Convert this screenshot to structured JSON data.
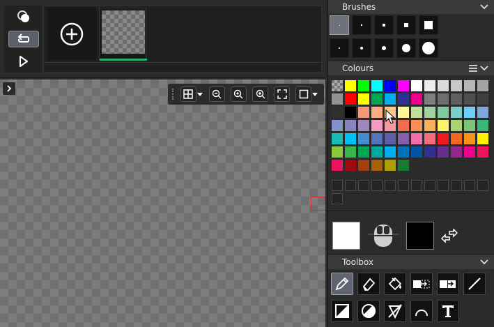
{
  "panels": {
    "brushes_title": "Brushes",
    "colours_title": "Colours",
    "toolbox_title": "Toolbox"
  },
  "palette": [
    [
      "checker",
      "#ffff00",
      "#00ff00",
      "#00ffff",
      "#0000ff",
      "#ff00ff",
      "#ffffff",
      "#ececec",
      "#dadada",
      "#c8c8c8",
      "#b6b6b6",
      "#a4a4a4"
    ],
    [
      "#929292",
      "#ff0000",
      "#ffff00",
      "#00a651",
      "#00aeef",
      "#2e3192",
      "#ec008c",
      "#7f7f7f",
      "#6f6f6f",
      "#5f5f5f",
      "#4f4f4f",
      "#3f3f3f"
    ],
    [
      "#2f2f2f",
      "#000000",
      "#f7977a",
      "#f9ad81",
      "#fdc68a",
      "#fff79a",
      "#c4df9b",
      "#a3d39c",
      "#82ca9d",
      "#7bcdc8",
      "#6ecff6",
      "#7ea7d8"
    ],
    [
      "#8493ca",
      "#8882be",
      "#a187be",
      "#f49ac2",
      "#f6989d",
      "#f26c4f",
      "#f68e56",
      "#fbaf5d",
      "#fff467",
      "#acd373",
      "#7cc576",
      "#3bb878"
    ],
    [
      "#1abbb4",
      "#00bff3",
      "#448ccb",
      "#5674b9",
      "#605ca8",
      "#855fa8",
      "#f06eaa",
      "#f26d7d",
      "#ed1c24",
      "#f26522",
      "#f7941d",
      "#fff200"
    ],
    [
      "#8dc73f",
      "#39b54a",
      "#00a651",
      "#00a99d",
      "#00aeef",
      "#0072bc",
      "#0054a6",
      "#2e3192",
      "#662d91",
      "#92278f",
      "#ec008c",
      "#ed145b"
    ],
    [
      "#ed145b",
      "#9e0b0f",
      "#a0410d",
      "#a3620a",
      "#aba000",
      "#197b30"
    ]
  ],
  "colours": {
    "primary": "#ffffff",
    "secondary": "#000000"
  }
}
